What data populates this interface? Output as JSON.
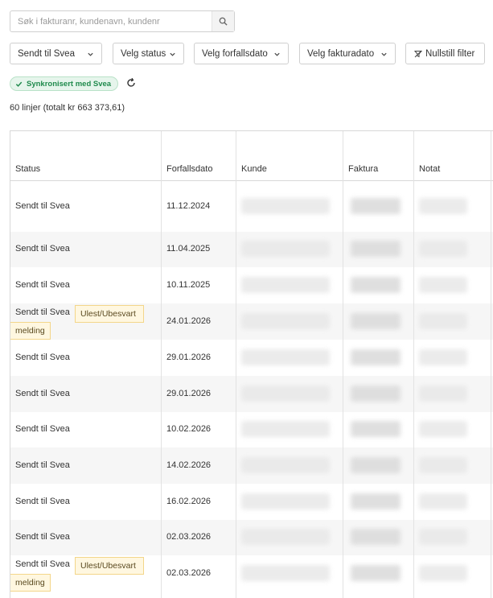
{
  "search": {
    "placeholder": "Søk i fakturanr, kundenavn, kundenr",
    "icon": "search-icon"
  },
  "filters": [
    {
      "label": "Sendt til Svea",
      "icon": "chevron-down-icon"
    },
    {
      "label": "Velg status",
      "icon": "chevron-down-icon"
    },
    {
      "label": "Velg forfallsdato",
      "icon": "chevron-down-icon"
    },
    {
      "label": "Velg fakturadato",
      "icon": "chevron-down-icon"
    },
    {
      "label": "Nullstill filter",
      "icon": "filter-clear-icon"
    }
  ],
  "sync": {
    "label": "Synkronisert med Svea",
    "icon": "check-icon",
    "refresh_icon": "refresh-icon"
  },
  "summary": "60 linjer (totalt kr 663 373,61)",
  "table": {
    "columns": [
      "Status",
      "Forfallsdato",
      "Kunde",
      "Faktura",
      "Notat"
    ],
    "rows": [
      {
        "status": "Sendt til Svea",
        "due": "11.12.2024",
        "badge": ""
      },
      {
        "status": "Sendt til Svea",
        "due": "11.04.2025",
        "badge": ""
      },
      {
        "status": "Sendt til Svea",
        "due": "10.11.2025",
        "badge": ""
      },
      {
        "status": "Sendt til Svea",
        "due": "24.01.2026",
        "badge": "Ulest/Ubesvart",
        "badge2": "melding"
      },
      {
        "status": "Sendt til Svea",
        "due": "29.01.2026",
        "badge": ""
      },
      {
        "status": "Sendt til Svea",
        "due": "29.01.2026",
        "badge": ""
      },
      {
        "status": "Sendt til Svea",
        "due": "10.02.2026",
        "badge": ""
      },
      {
        "status": "Sendt til Svea",
        "due": "14.02.2026",
        "badge": ""
      },
      {
        "status": "Sendt til Svea",
        "due": "16.02.2026",
        "badge": ""
      },
      {
        "status": "Sendt til Svea",
        "due": "02.03.2026",
        "badge": ""
      },
      {
        "status": "Sendt til Svea",
        "due": "02.03.2026",
        "badge": "Ulest/Ubesvart",
        "badge2": "melding"
      }
    ]
  },
  "colors": {
    "sync_green": "#1f8a4c",
    "sync_bg": "#e6f5ec",
    "badge_bg": "#fff7e0",
    "badge_border": "#f3d68a",
    "row_alt": "#f6f6f6"
  }
}
